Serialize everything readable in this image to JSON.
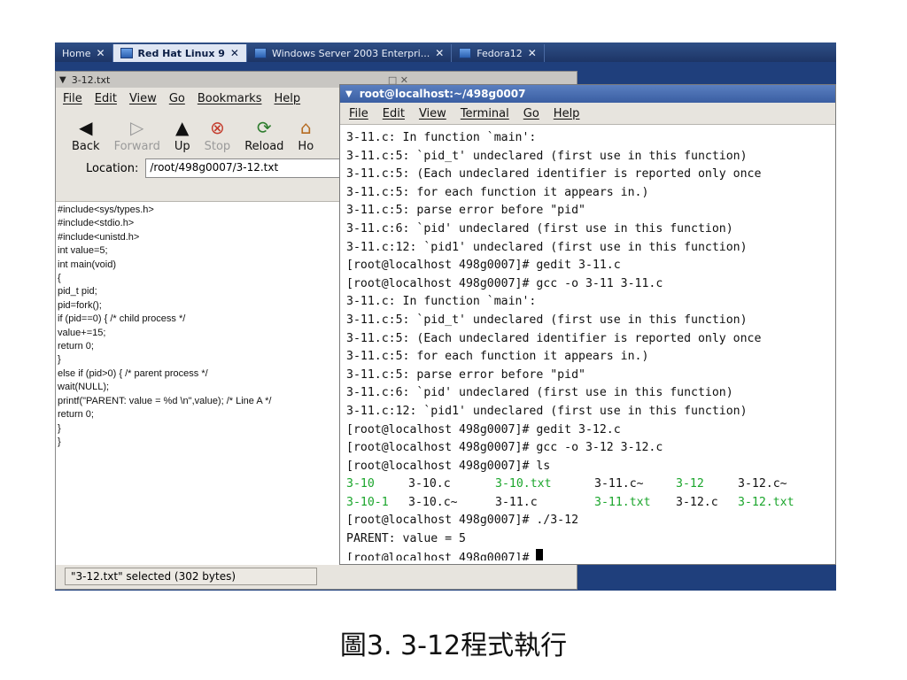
{
  "tabs": [
    {
      "label": "Home",
      "active": false
    },
    {
      "label": "Red Hat Linux 9",
      "active": true
    },
    {
      "label": "Windows Server 2003 Enterpri...",
      "active": false
    },
    {
      "label": "Fedora12",
      "active": false
    }
  ],
  "nautilus": {
    "window_title": "3-12.txt",
    "menu": [
      "File",
      "Edit",
      "View",
      "Go",
      "Bookmarks",
      "Help"
    ],
    "toolbar": [
      {
        "label": "Back",
        "icon": "back-arrow-icon"
      },
      {
        "label": "Forward",
        "icon": "forward-arrow-icon"
      },
      {
        "label": "Up",
        "icon": "up-arrow-icon"
      },
      {
        "label": "Stop",
        "icon": "stop-icon"
      },
      {
        "label": "Reload",
        "icon": "reload-icon"
      },
      {
        "label": "Ho",
        "icon": "home-icon"
      }
    ],
    "location_label": "Location:",
    "location_value": "/root/498g0007/3-12.txt",
    "code": [
      "#include<sys/types.h>",
      "#include<stdio.h>",
      "#include<unistd.h>",
      "int value=5;",
      "int main(void)",
      "{",
      "pid_t pid;",
      "pid=fork();",
      "if (pid==0) { /* child process */",
      "value+=15;",
      "return 0;",
      "}",
      "else if (pid>0) { /* parent process */",
      "wait(NULL);",
      "printf(\"PARENT: value = %d \\n\",value); /* Line A */",
      "return 0;",
      "}",
      "}"
    ],
    "status": "\"3-12.txt\" selected (302 bytes)"
  },
  "terminal": {
    "title": "root@localhost:~/498g0007",
    "menu": [
      "File",
      "Edit",
      "View",
      "Terminal",
      "Go",
      "Help"
    ],
    "lines": [
      "3-11.c: In function `main':",
      "3-11.c:5: `pid_t' undeclared (first use in this function)",
      "3-11.c:5: (Each undeclared identifier is reported only once",
      "3-11.c:5: for each function it appears in.)",
      "3-11.c:5: parse error before \"pid\"",
      "3-11.c:6: `pid' undeclared (first use in this function)",
      "3-11.c:12: `pid1' undeclared (first use in this function)",
      "[root@localhost 498g0007]# gedit 3-11.c",
      "[root@localhost 498g0007]# gcc -o 3-11 3-11.c",
      "3-11.c: In function `main':",
      "3-11.c:5: `pid_t' undeclared (first use in this function)",
      "3-11.c:5: (Each undeclared identifier is reported only once",
      "3-11.c:5: for each function it appears in.)",
      "3-11.c:5: parse error before \"pid\"",
      "3-11.c:6: `pid' undeclared (first use in this function)",
      "3-11.c:12: `pid1' undeclared (first use in this function)",
      "[root@localhost 498g0007]# gedit 3-12.c",
      "[root@localhost 498g0007]# gcc -o 3-12 3-12.c",
      "[root@localhost 498g0007]# ls"
    ],
    "ls_row1": [
      {
        "name": "3-10",
        "green": true
      },
      {
        "name": "3-10.c",
        "green": false
      },
      {
        "name": "3-10.txt",
        "green": true
      },
      {
        "name": "3-11.c~",
        "green": false
      },
      {
        "name": "3-12",
        "green": true
      },
      {
        "name": "3-12.c~",
        "green": false
      }
    ],
    "ls_row2": [
      {
        "name": "3-10-1",
        "green": true
      },
      {
        "name": "3-10.c~",
        "green": false
      },
      {
        "name": "3-11.c",
        "green": false
      },
      {
        "name": "3-11.txt",
        "green": true
      },
      {
        "name": "3-12.c",
        "green": false
      },
      {
        "name": "3-12.txt",
        "green": true
      }
    ],
    "after_lines": [
      "[root@localhost 498g0007]# ./3-12",
      "PARENT: value = 5"
    ],
    "prompt_last": "[root@localhost 498g0007]# "
  },
  "caption": "圖3. 3-12程式執行",
  "colors": {
    "green": "#1aa52b",
    "term_title": "#3a5ea2",
    "tabbar": "#1d3566"
  }
}
